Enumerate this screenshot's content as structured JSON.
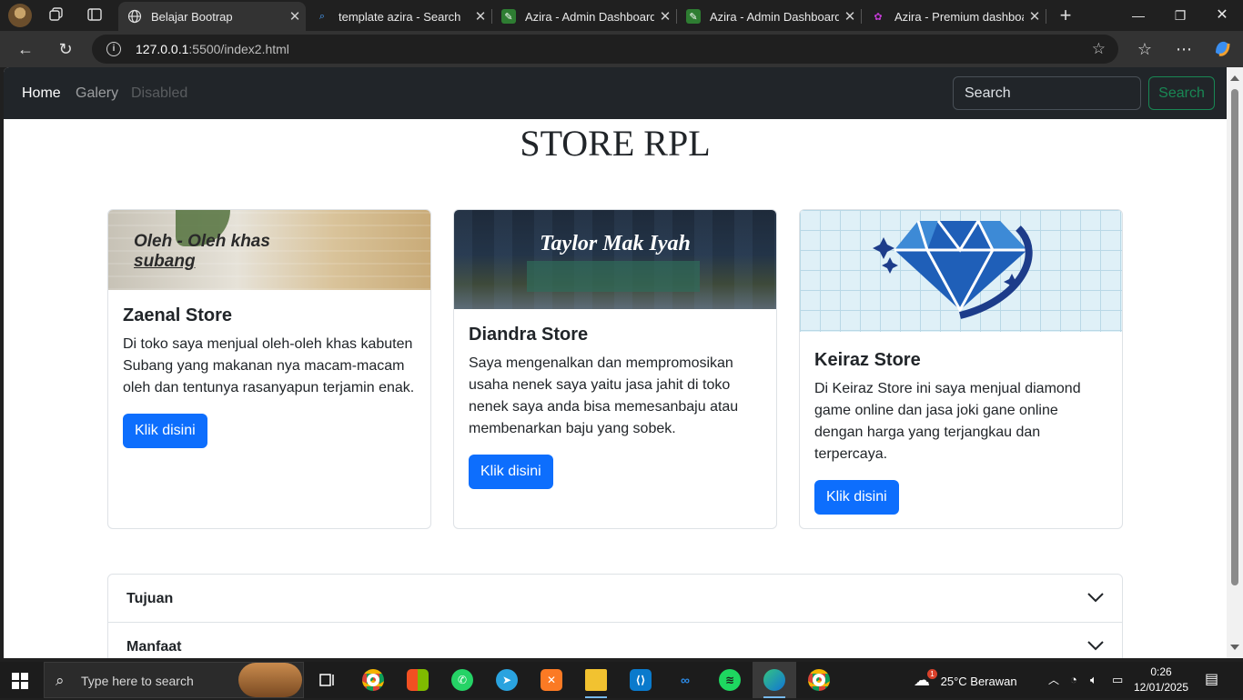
{
  "browser": {
    "tabs": [
      {
        "title": "Belajar Bootrap",
        "active": true
      },
      {
        "title": "template azira - Search",
        "active": false
      },
      {
        "title": "Azira - Admin Dashboard H",
        "active": false
      },
      {
        "title": "Azira - Admin Dashboard H",
        "active": false
      },
      {
        "title": "Azira - Premium dashboard",
        "active": false
      }
    ],
    "url_host": "127.0.0.1",
    "url_path": ":5500/index2.html"
  },
  "navbar": {
    "links": [
      {
        "label": "Home"
      },
      {
        "label": "Galery"
      },
      {
        "label": "Disabled"
      }
    ],
    "search_placeholder": "Search",
    "search_button": "Search"
  },
  "page": {
    "title": "STORE RPL",
    "cards": [
      {
        "image_caption_1": "Oleh - Oleh khas",
        "image_caption_2": "subang",
        "title": "Zaenal Store",
        "text": "Di toko saya menjual oleh-oleh khas kabuten Subang yang makanan nya macam-macam oleh dan tentunya rasanyapun terjamin enak.",
        "button": "Klik disini"
      },
      {
        "image_caption_1": "Taylor Mak Iyah",
        "title": "Diandra Store",
        "text": "Saya mengenalkan dan mempromosikan usaha nenek saya yaitu jasa jahit di toko nenek saya anda bisa memesanbaju atau membenarkan baju yang sobek.",
        "button": "Klik disini"
      },
      {
        "title": "Keiraz Store",
        "text": "Di Keiraz Store ini saya menjual diamond game online dan jasa joki gane online dengan harga yang terjangkau dan terpercaya.",
        "button": "Klik disini"
      }
    ],
    "accordion": [
      {
        "title": "Tujuan"
      },
      {
        "title": "Manfaat"
      }
    ]
  },
  "taskbar": {
    "search_placeholder": "Type here to search",
    "weather": "25°C  Berawan",
    "weather_badge": "1",
    "time": "0:26",
    "date": "12/01/2025"
  },
  "colors": {
    "primary": "#0d6efd",
    "success": "#198754",
    "navbar_bg": "#212529"
  }
}
